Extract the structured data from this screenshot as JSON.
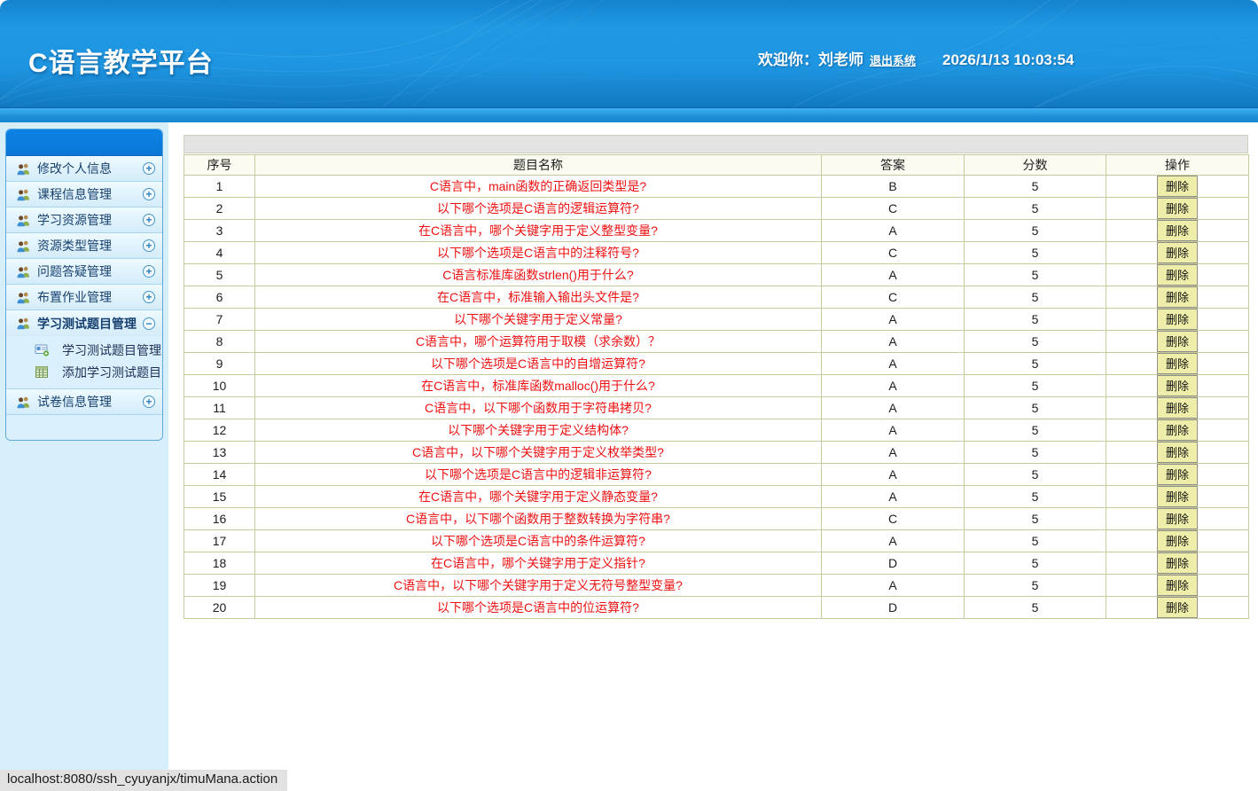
{
  "colors": {
    "question_red": "#ee1111",
    "delete_btn_bg": "#eeeeaa",
    "header_blue": "#1e90dd",
    "sidebar_bg": "#d7eefb"
  },
  "header": {
    "title": "C语言教学平台",
    "welcome_prefix": "欢迎你：",
    "username": "刘老师",
    "logout_label": "退出系统",
    "datetime": "2026/1/13 10:03:54"
  },
  "sidebar": {
    "items": [
      {
        "label": "修改个人信息",
        "expand": "plus"
      },
      {
        "label": "课程信息管理",
        "expand": "plus"
      },
      {
        "label": "学习资源管理",
        "expand": "plus"
      },
      {
        "label": "资源类型管理",
        "expand": "plus"
      },
      {
        "label": "问题答疑管理",
        "expand": "plus"
      },
      {
        "label": "布置作业管理",
        "expand": "plus"
      },
      {
        "label": "学习测试题目管理",
        "expand": "minus",
        "bold": true,
        "children": [
          {
            "label": "学习测试题目管理",
            "icon": "card-add-icon"
          },
          {
            "label": "添加学习测试题目",
            "icon": "table-icon"
          }
        ]
      },
      {
        "label": "试卷信息管理",
        "expand": "plus"
      }
    ]
  },
  "table": {
    "headers": [
      "序号",
      "题目名称",
      "答案",
      "分数",
      "操作"
    ],
    "delete_label": "删除",
    "rows": [
      {
        "no": "1",
        "title": "C语言中，main函数的正确返回类型是?",
        "answer": "B",
        "score": "5"
      },
      {
        "no": "2",
        "title": "以下哪个选项是C语言的逻辑运算符?",
        "answer": "C",
        "score": "5"
      },
      {
        "no": "3",
        "title": "在C语言中，哪个关键字用于定义整型变量?",
        "answer": "A",
        "score": "5"
      },
      {
        "no": "4",
        "title": "以下哪个选项是C语言中的注释符号?",
        "answer": "C",
        "score": "5"
      },
      {
        "no": "5",
        "title": "C语言标准库函数strlen()用于什么?",
        "answer": "A",
        "score": "5"
      },
      {
        "no": "6",
        "title": "在C语言中，标准输入输出头文件是?",
        "answer": "C",
        "score": "5"
      },
      {
        "no": "7",
        "title": "以下哪个关键字用于定义常量?",
        "answer": "A",
        "score": "5"
      },
      {
        "no": "8",
        "title": "C语言中，哪个运算符用于取模（求余数）？",
        "answer": "A",
        "score": "5"
      },
      {
        "no": "9",
        "title": "以下哪个选项是C语言中的自增运算符?",
        "answer": "A",
        "score": "5"
      },
      {
        "no": "10",
        "title": "在C语言中，标准库函数malloc()用于什么?",
        "answer": "A",
        "score": "5"
      },
      {
        "no": "11",
        "title": "C语言中，以下哪个函数用于字符串拷贝?",
        "answer": "A",
        "score": "5"
      },
      {
        "no": "12",
        "title": "以下哪个关键字用于定义结构体?",
        "answer": "A",
        "score": "5"
      },
      {
        "no": "13",
        "title": "C语言中，以下哪个关键字用于定义枚举类型?",
        "answer": "A",
        "score": "5"
      },
      {
        "no": "14",
        "title": "以下哪个选项是C语言中的逻辑非运算符?",
        "answer": "A",
        "score": "5"
      },
      {
        "no": "15",
        "title": "在C语言中，哪个关键字用于定义静态变量?",
        "answer": "A",
        "score": "5"
      },
      {
        "no": "16",
        "title": "C语言中，以下哪个函数用于整数转换为字符串?",
        "answer": "C",
        "score": "5"
      },
      {
        "no": "17",
        "title": "以下哪个选项是C语言中的条件运算符?",
        "answer": "A",
        "score": "5"
      },
      {
        "no": "18",
        "title": "在C语言中，哪个关键字用于定义指针?",
        "answer": "D",
        "score": "5"
      },
      {
        "no": "19",
        "title": "C语言中，以下哪个关键字用于定义无符号整型变量?",
        "answer": "A",
        "score": "5"
      },
      {
        "no": "20",
        "title": "以下哪个选项是C语言中的位运算符?",
        "answer": "D",
        "score": "5"
      }
    ]
  },
  "status_bar": {
    "url": "localhost:8080/ssh_cyuyanjx/timuMana.action"
  }
}
